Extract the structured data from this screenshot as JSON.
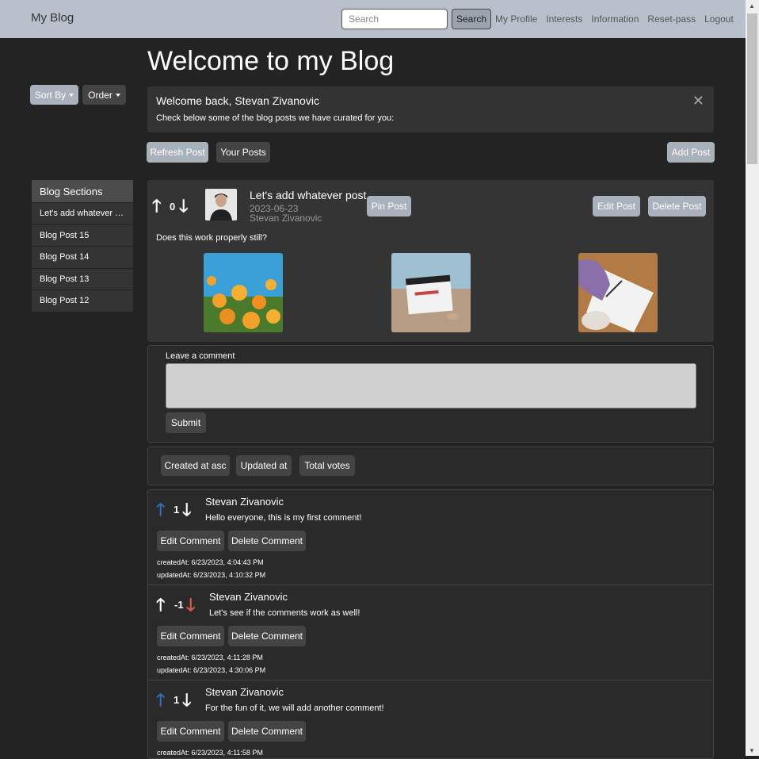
{
  "navbar": {
    "brand": "My Blog",
    "search_placeholder": "Search",
    "search_button": "Search",
    "links": [
      "My Profile",
      "Interests",
      "Information",
      "Reset-pass",
      "Logout"
    ]
  },
  "page_title": "Welcome to my Blog",
  "controls": {
    "sort_by": "Sort By",
    "order": "Order"
  },
  "welcome": {
    "title": "Welcome back, Stevan Zivanovic",
    "text": "Check below some of the blog posts we have curated for you:"
  },
  "actions": {
    "refresh": "Refresh Post",
    "your_posts": "Your Posts",
    "add_post": "Add Post"
  },
  "sidebar": {
    "title": "Blog Sections",
    "items": [
      "Let's add whatever post",
      "Blog Post 15",
      "Blog Post 14",
      "Blog Post 13",
      "Blog Post 12"
    ]
  },
  "post": {
    "votes": "0",
    "title": "Let's add whatever post",
    "date": "2023-06-23",
    "author": "Stevan Zivanovic",
    "pin": "Pin Post",
    "edit": "Edit Post",
    "delete": "Delete Post",
    "body": "Does this work properly still?"
  },
  "comment_form": {
    "label": "Leave a comment",
    "submit": "Submit"
  },
  "sort_buttons": [
    "Created at asc",
    "Updated at",
    "Total votes"
  ],
  "comments": [
    {
      "votes": "1",
      "author": "Stevan Zivanovic",
      "text": "Hello everyone, this is my first comment!",
      "created": "createdAt: 6/23/2023, 4:04:43 PM",
      "updated": "updatedAt: 6/23/2023, 4:10:32 PM"
    },
    {
      "votes": "-1",
      "author": "Stevan Zivanovic",
      "text": "Let's see if the comments work as well!",
      "created": "createdAt: 6/23/2023, 4:11:28 PM",
      "updated": "updatedAt: 6/23/2023, 4:30:06 PM"
    },
    {
      "votes": "1",
      "author": "Stevan Zivanovic",
      "text": "For the fun of it, we will add another comment!",
      "created": "createdAt: 6/23/2023, 4:11:58 PM",
      "updated": ""
    }
  ],
  "comment_actions": {
    "edit": "Edit Comment",
    "delete": "Delete Comment"
  },
  "colors": {
    "upvoted": "#2f6fb3",
    "downvoted": "#e05a4a",
    "navbar": "#b8c1cb"
  }
}
